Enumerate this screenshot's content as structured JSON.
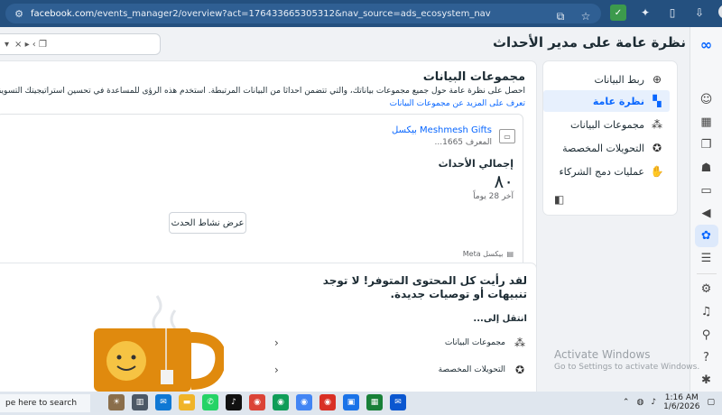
{
  "browser": {
    "url_host": "facebook.com",
    "url_path": "/events_manager2/overview?act=176433665305312&nav_source=ads_ecosystem_nav"
  },
  "page": {
    "title": "نظرة عامة على مدير الأحداث",
    "date_range": "‎× ▸ ‹ ❐"
  },
  "nav": {
    "items": [
      {
        "label": "ربط البيانات",
        "icon": "plus-circle-icon"
      },
      {
        "label": "نظرة عامة",
        "icon": "overview-grid-icon"
      },
      {
        "label": "مجموعات البيانات",
        "icon": "datasets-icon"
      },
      {
        "label": "التحويلات المخصصة",
        "icon": "custom-conversions-icon"
      },
      {
        "label": "عمليات دمج الشركاء",
        "icon": "partner-integrations-icon"
      }
    ]
  },
  "datasets": {
    "title": "مجموعات البيانات",
    "description": "احصل على نظرة عامة حول جميع مجموعات بياناتك، والتي تتضمن أحداثاً من البيانات المرتبطة. استخدم هذه الرؤى للمساعدة في تحسين استراتيجيتك التسويقية.",
    "learn_more": "تعرف على المزيد عن مجموعات البيانات",
    "pixel": {
      "name": "Meshmesh Gifts بيكسل",
      "id_label": "المعرف",
      "id_value": "1665...",
      "total_label": "إجمالي الأحداث",
      "total_value": "٨٠",
      "period": "آخر 28 يوماً",
      "button": "عرض نشاط الحدث",
      "source": "بيكسل Meta"
    }
  },
  "recommendations": {
    "title": "لقد رأيت كل المحتوى المتوفر! لا توجد تنبيهات أو توصيات جديدة.",
    "goto_label": "انتقل إلى...",
    "links": [
      {
        "label": "مجموعات البيانات",
        "icon": "datasets-icon"
      },
      {
        "label": "التحويلات المخصصة",
        "icon": "custom-conversions-icon"
      }
    ]
  },
  "watermark": {
    "title": "Activate Windows",
    "subtitle": "Go to Settings to activate Windows."
  },
  "taskbar": {
    "search_placeholder": "pe here to search",
    "time": "1:16 AM",
    "date": "1/6/2026"
  },
  "colors": {
    "accent": "#0866ff",
    "browser_bar": "#24507f",
    "page_bg": "#f0f2f5"
  }
}
